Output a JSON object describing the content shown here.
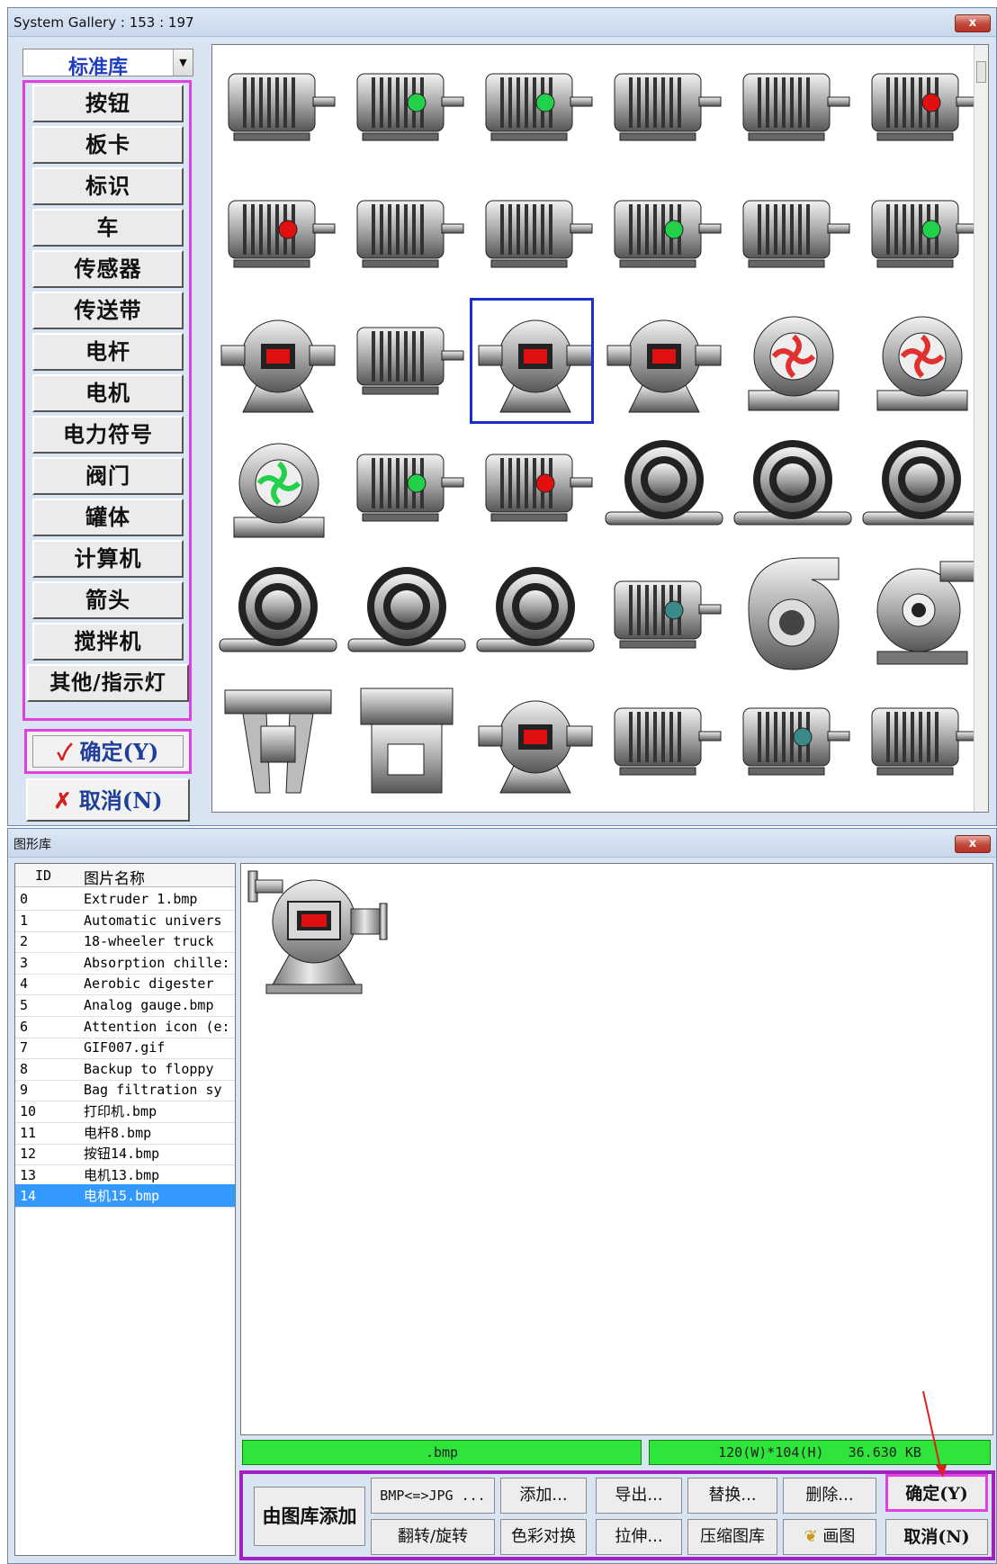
{
  "top_window": {
    "title": "System Gallery : 153 : 197",
    "close_label": "x",
    "library_select": "标准库",
    "categories": [
      "按钮",
      "板卡",
      "标识",
      "车",
      "传感器",
      "传送带",
      "电杆",
      "电机",
      "电力符号",
      "阀门",
      "罐体",
      "计算机",
      "箭头",
      "搅拌机",
      "其他/指示灯"
    ],
    "ok_check": "✓",
    "ok_label": "确定(Y)",
    "cancel_x": "✗",
    "cancel_label": "取消(N)",
    "selected_thumbnail_index": 14
  },
  "bottom_window": {
    "title": "图形库",
    "close_label": "x",
    "list_headers": {
      "id": "ID",
      "name": "图片名称"
    },
    "rows": [
      {
        "id": "0",
        "name": "Extruder 1.bmp"
      },
      {
        "id": "1",
        "name": "Automatic univers"
      },
      {
        "id": "2",
        "name": "18-wheeler truck"
      },
      {
        "id": "3",
        "name": "Absorption chille:"
      },
      {
        "id": "4",
        "name": "Aerobic digester"
      },
      {
        "id": "5",
        "name": "Analog gauge.bmp"
      },
      {
        "id": "6",
        "name": "Attention icon (e:"
      },
      {
        "id": "7",
        "name": "GIF007.gif"
      },
      {
        "id": "8",
        "name": "Backup to floppy"
      },
      {
        "id": "9",
        "name": "Bag filtration sy"
      },
      {
        "id": "10",
        "name": "打印机.bmp"
      },
      {
        "id": "11",
        "name": "电杆8.bmp"
      },
      {
        "id": "12",
        "name": "按钮14.bmp"
      },
      {
        "id": "13",
        "name": "电机13.bmp"
      },
      {
        "id": "14",
        "name": "电机15.bmp"
      }
    ],
    "selected_row": "14",
    "status_type": ".bmp",
    "status_info": "120(W)*104(H)   36.630 KB",
    "buttons": {
      "add_from_lib": "由图库添加",
      "bmp_jpg": "BMP<=>JPG ...",
      "add": "添加...",
      "export": "导出...",
      "replace": "替换...",
      "delete": "删除...",
      "ok": "确定(Y)",
      "flip_rotate": "翻转/旋转",
      "color_swap": "色彩对换",
      "stretch": "拉伸...",
      "compress": "压缩图库",
      "draw": "画图",
      "cancel": "取消(N)"
    }
  },
  "colors": {
    "accent_magenta": "#e040e0",
    "select_blue": "#1a2fc8",
    "status_green": "#2fe43a",
    "row_highlight": "#3399ff"
  }
}
